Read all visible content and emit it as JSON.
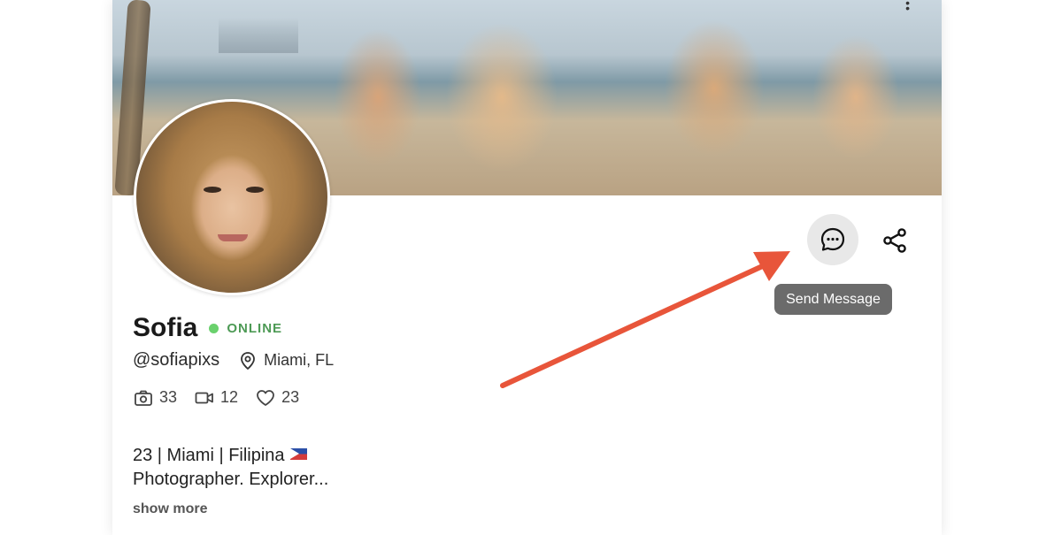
{
  "profile": {
    "name": "Sofia",
    "status": "ONLINE",
    "handle": "@sofiapixs",
    "location": "Miami, FL",
    "bio_line1": "23 | Miami | Filipina",
    "bio_line2": "Photographer. Explorer...",
    "show_more": "show more"
  },
  "stats": {
    "photos": "33",
    "videos": "12",
    "likes": "23"
  },
  "actions": {
    "tooltip": "Send Message"
  },
  "icons": {
    "message": "chat-bubble-icon",
    "share": "share-icon",
    "location": "map-pin-icon",
    "photos": "camera-icon",
    "videos": "video-icon",
    "likes": "heart-icon",
    "menu": "more-vertical-icon",
    "flag": "philippines-flag-icon"
  },
  "colors": {
    "online": "#6ad16d",
    "online_text": "#4d9a55",
    "annotation_arrow": "#e8553a",
    "tooltip_bg": "#6b6b6b",
    "button_bg": "#e8e8e8"
  }
}
